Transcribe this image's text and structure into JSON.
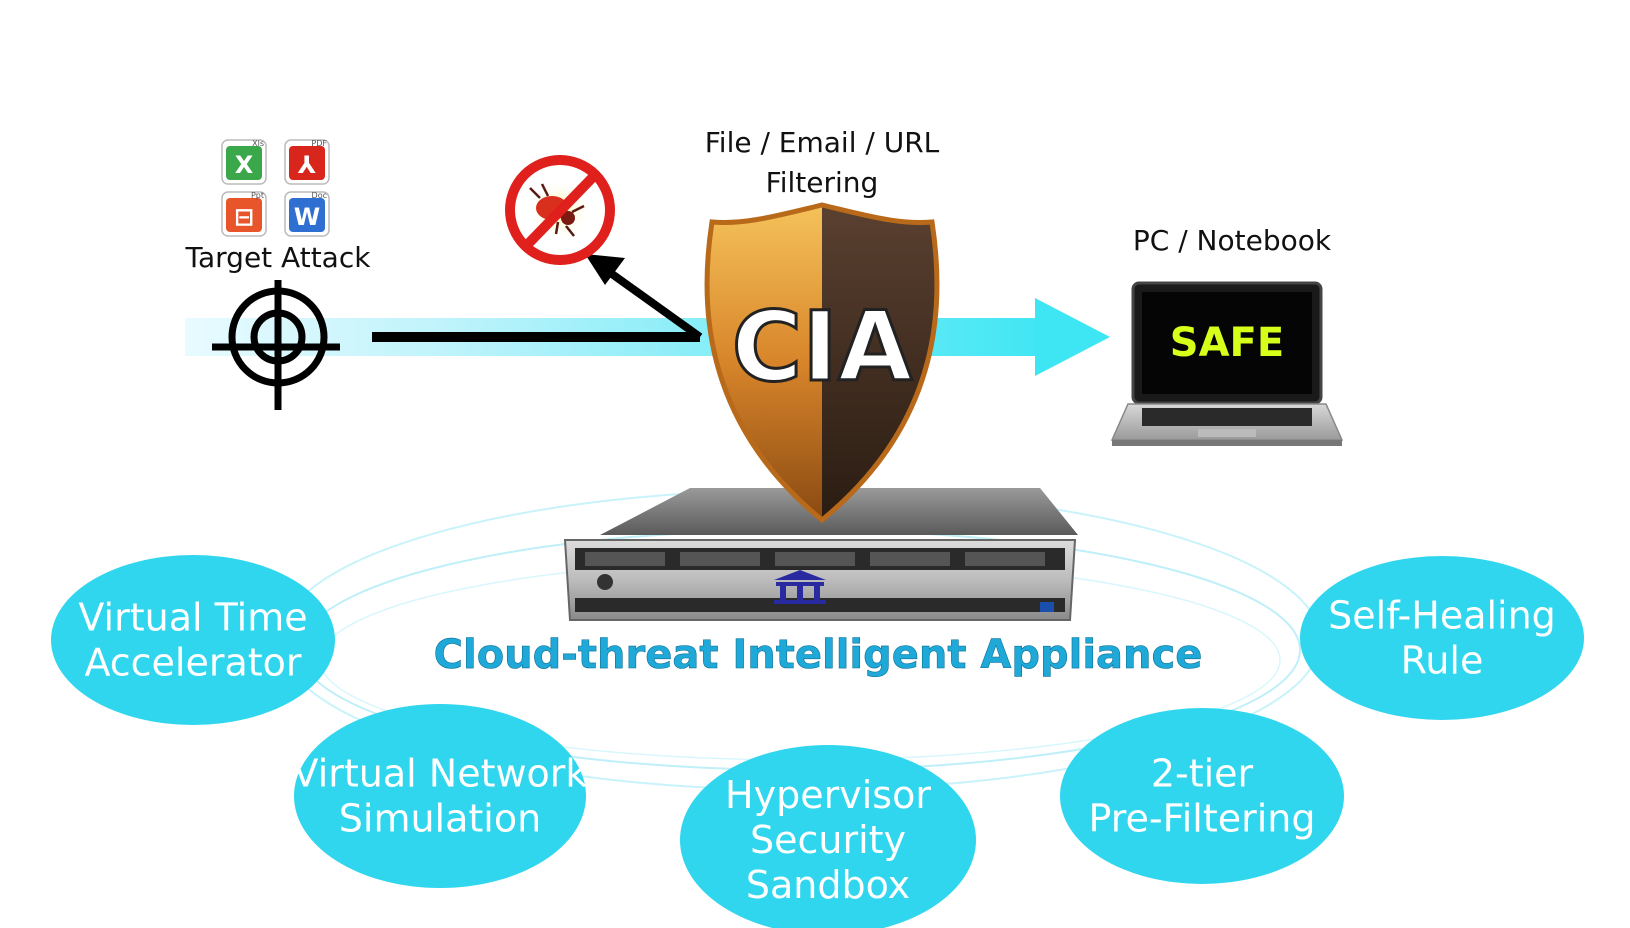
{
  "labels": {
    "target_attack": "Target Attack",
    "filter_line1": "File / Email / URL",
    "filter_line2": "Filtering",
    "pc_notebook": "PC / Notebook",
    "shield_text": "CIA",
    "screen_text": "SAFE",
    "appliance_title": "Cloud-threat Intelligent Appliance"
  },
  "file_icons": [
    {
      "name": "excel-icon",
      "tag": "Xls",
      "glyph": "X",
      "color": "#3aa84a"
    },
    {
      "name": "pdf-icon",
      "tag": "PDF",
      "glyph": "⅄",
      "color": "#d9261c"
    },
    {
      "name": "powerpoint-icon",
      "tag": "Ppt",
      "glyph": "⊟",
      "color": "#e8552b"
    },
    {
      "name": "word-icon",
      "tag": "Doc",
      "glyph": "W",
      "color": "#2f6fd2"
    }
  ],
  "features": [
    {
      "id": "virtual-time",
      "line1": "Virtual Time",
      "line2": "Accelerator",
      "line3": ""
    },
    {
      "id": "virtual-network",
      "line1": "Virtual Network",
      "line2": "Simulation",
      "line3": ""
    },
    {
      "id": "hypervisor",
      "line1": "Hypervisor",
      "line2": "Security",
      "line3": "Sandbox"
    },
    {
      "id": "two-tier",
      "line1": "2-tier",
      "line2": "Pre-Filtering",
      "line3": ""
    },
    {
      "id": "self-healing",
      "line1": "Self-Healing",
      "line2": "Rule",
      "line3": ""
    }
  ],
  "colors": {
    "bubble": "#2fd6ee",
    "flow_arrow": "#3ee6f4",
    "title_blue": "#1ea9d8",
    "screen_text": "#d6ff1a",
    "shield_gold": "#d8912a",
    "shield_dark": "#3a2a1e",
    "ban_red": "#e0201c"
  }
}
